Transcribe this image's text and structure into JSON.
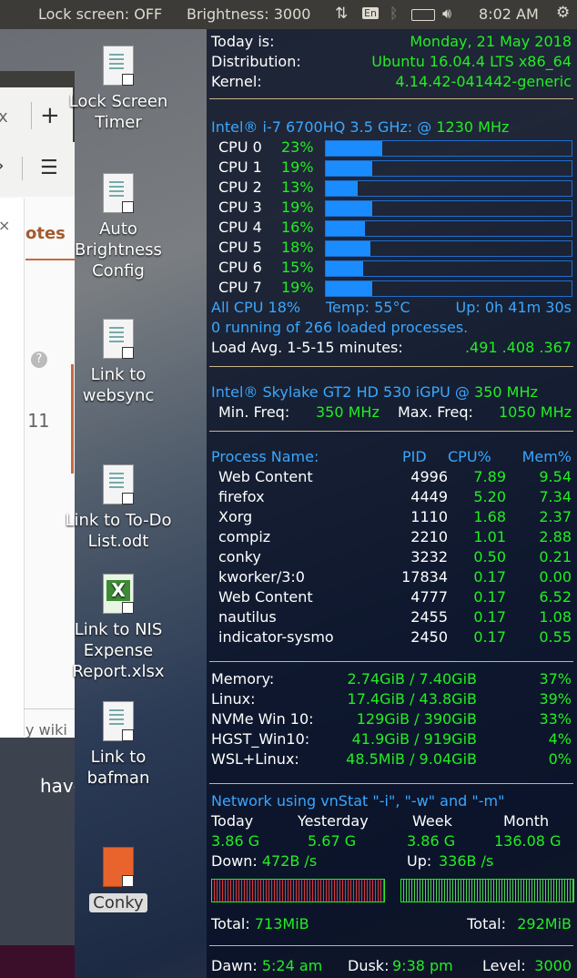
{
  "panel": {
    "lock_screen": "Lock screen: OFF",
    "brightness": "Brightness: 3000",
    "keyboard": "En",
    "clock": "8:02 AM"
  },
  "desktop_icons": [
    {
      "label": "Lock Screen Timer"
    },
    {
      "label": "Auto Brightness Config"
    },
    {
      "label": "Link to websync"
    },
    {
      "label": "Link to To-Do List.odt"
    },
    {
      "label": "Link to NIS Expense Report.xlsx"
    },
    {
      "label": "Link to bafman"
    },
    {
      "label": "Conky"
    }
  ],
  "firefox_fragments": {
    "tab_close": "x",
    "new_tab": "+",
    "menu": "☰",
    "notes": "otes",
    "help": "?",
    "number": "11",
    "wiki": "y wiki",
    "have": "have"
  },
  "conky": {
    "info": [
      {
        "label": "Today is:",
        "value": "Monday, 21 May 2018"
      },
      {
        "label": "Distribution:",
        "value": "Ubuntu 16.04.4 LTS x86_64"
      },
      {
        "label": "Kernel:",
        "value": "4.14.42-041442-generic"
      }
    ],
    "cpu_title": "Intel® i-7 6700HQ 3.5 GHz: @ ",
    "cpu_freq": "1230 MHz",
    "cpus": [
      {
        "name": "CPU 0",
        "pct": "23%",
        "load": 0.23
      },
      {
        "name": "CPU 1",
        "pct": "19%",
        "load": 0.19
      },
      {
        "name": "CPU 2",
        "pct": "13%",
        "load": 0.13
      },
      {
        "name": "CPU 3",
        "pct": "19%",
        "load": 0.19
      },
      {
        "name": "CPU 4",
        "pct": "16%",
        "load": 0.16
      },
      {
        "name": "CPU 5",
        "pct": "18%",
        "load": 0.18
      },
      {
        "name": "CPU 6",
        "pct": "15%",
        "load": 0.15
      },
      {
        "name": "CPU 7",
        "pct": "19%",
        "load": 0.19
      }
    ],
    "all_cpu": "All CPU 18%",
    "temp": "Temp: 55°C",
    "uptime": "Up: 0h 41m 30s",
    "processes": "0 running of 266 loaded processes.",
    "load_label": "Load Avg. 1-5-15 minutes:",
    "load_value": ".491 .408 .367",
    "gpu_title": "Intel® Skylake GT2 HD 530 iGPU @ ",
    "gpu_freq": "350 MHz",
    "min_label": "Min. Freq:",
    "min_value": "350 MHz",
    "max_label": "Max. Freq:",
    "max_value": "1050 MHz",
    "proc_headers": {
      "name": "Process Name:",
      "pid": "PID",
      "cpu": "CPU%",
      "mem": "Mem%"
    },
    "procs": [
      {
        "name": "Web Content",
        "pid": "4996",
        "cpu": "7.89",
        "mem": "9.54"
      },
      {
        "name": "firefox",
        "pid": "4449",
        "cpu": "5.20",
        "mem": "7.34"
      },
      {
        "name": "Xorg",
        "pid": "1110",
        "cpu": "1.68",
        "mem": "2.37"
      },
      {
        "name": "compiz",
        "pid": "2210",
        "cpu": "1.01",
        "mem": "2.88"
      },
      {
        "name": "conky",
        "pid": "3232",
        "cpu": "0.50",
        "mem": "0.21"
      },
      {
        "name": "kworker/3:0",
        "pid": "17834",
        "cpu": "0.17",
        "mem": "0.00"
      },
      {
        "name": "Web Content",
        "pid": "4777",
        "cpu": "0.17",
        "mem": "6.52"
      },
      {
        "name": "nautilus",
        "pid": "2455",
        "cpu": "0.17",
        "mem": "1.08"
      },
      {
        "name": "indicator-sysmo",
        "pid": "2450",
        "cpu": "0.17",
        "mem": "0.55"
      }
    ],
    "storage": [
      {
        "label": "Memory:",
        "used": "2.74GiB / 7.40GiB",
        "pct": "37%"
      },
      {
        "label": "Linux:",
        "used": "17.4GiB / 43.8GiB",
        "pct": "39%"
      },
      {
        "label": "NVMe Win 10:",
        "used": "129GiB / 390GiB",
        "pct": "33%"
      },
      {
        "label": "HGST_Win10:",
        "used": "41.9GiB / 919GiB",
        "pct": "4%"
      },
      {
        "label": "WSL+Linux:",
        "used": "48.5MiB / 9.04GiB",
        "pct": "0%"
      }
    ],
    "net_title": "Network using vnStat \"-i\", \"-w\" and \"-m\"",
    "net_headers": [
      "Today",
      "Yesterday",
      "Week",
      "Month"
    ],
    "net_values": [
      "3.86 G",
      "5.67 G",
      "3.86 G",
      "136.08 G"
    ],
    "down_label": "Down:",
    "down_value": "472B  /s",
    "up_label": "Up:",
    "up_value": "336B  /s",
    "total_label": "Total:",
    "total_down": "713MiB",
    "total_up": "292MiB",
    "dawn_label": "Dawn:",
    "dawn_value": "5:24 am",
    "dusk_label": "Dusk:",
    "dusk_value": "9:38 pm",
    "level_label": "Level:",
    "level_value": "3000"
  }
}
